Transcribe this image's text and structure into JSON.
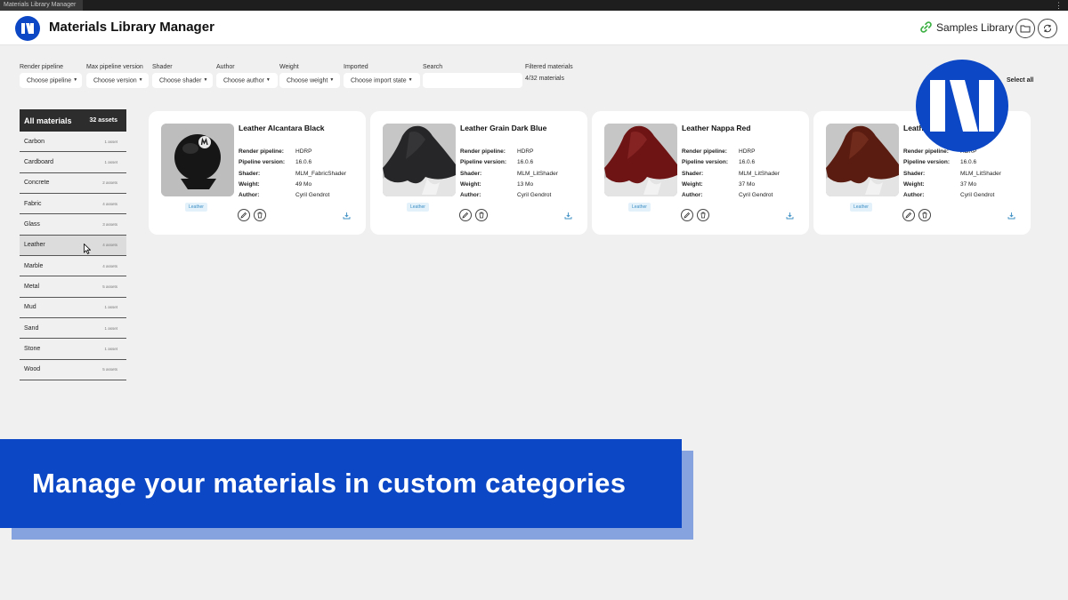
{
  "window": {
    "tab_title": "Materials Library Manager"
  },
  "header": {
    "title": "Materials Library Manager",
    "samples_label": "Samples Library",
    "logo_icon": "mlm-logo-icon",
    "accent": "#0c47c6"
  },
  "filters": [
    {
      "label": "Render pipeline",
      "placeholder": "Choose pipeline"
    },
    {
      "label": "Max pipeline version",
      "placeholder": "Choose version"
    },
    {
      "label": "Shader",
      "placeholder": "Choose shader"
    },
    {
      "label": "Author",
      "placeholder": "Choose author"
    },
    {
      "label": "Weight",
      "placeholder": "Choose weight"
    },
    {
      "label": "Imported",
      "placeholder": "Choose import state"
    }
  ],
  "search": {
    "label": "Search",
    "value": ""
  },
  "filtered": {
    "label": "Filtered materials",
    "count": "4/32 materials"
  },
  "select_all": "Select all",
  "sidebar": {
    "header": {
      "label": "All materials",
      "count": "32 assets"
    },
    "items": [
      {
        "name": "Carbon",
        "count": "1 asset"
      },
      {
        "name": "Cardboard",
        "count": "1 asset"
      },
      {
        "name": "Concrete",
        "count": "2 assets"
      },
      {
        "name": "Fabric",
        "count": "4 assets"
      },
      {
        "name": "Glass",
        "count": "3 assets"
      },
      {
        "name": "Leather",
        "count": "4 assets"
      },
      {
        "name": "Marble",
        "count": "4 assets"
      },
      {
        "name": "Metal",
        "count": "5 assets"
      },
      {
        "name": "Mud",
        "count": "1 asset"
      },
      {
        "name": "Sand",
        "count": "1 asset"
      },
      {
        "name": "Stone",
        "count": "1 asset"
      },
      {
        "name": "Wood",
        "count": "5 assets"
      }
    ]
  },
  "prop_labels": {
    "pipeline": "Render pipeline:",
    "version": "Pipeline version:",
    "shader": "Shader:",
    "weight": "Weight:",
    "author": "Author:"
  },
  "materials": [
    {
      "name": "Leather Alcantara Black",
      "pipeline": "HDRP",
      "version": "16.0.6",
      "shader": "MLM_FabricShader",
      "weight": "49 Mo",
      "author": "Cyril Gendrot",
      "tag": "Leather",
      "color": "#1c1c1c"
    },
    {
      "name": "Leather Grain Dark Blue",
      "pipeline": "HDRP",
      "version": "16.0.6",
      "shader": "MLM_LitShader",
      "weight": "13 Mo",
      "author": "Cyril Gendrot",
      "tag": "Leather",
      "color": "#262628"
    },
    {
      "name": "Leather Nappa Red",
      "pipeline": "HDRP",
      "version": "16.0.6",
      "shader": "MLM_LitShader",
      "weight": "37 Mo",
      "author": "Cyril Gendrot",
      "tag": "Leather",
      "color": "#6e1414"
    },
    {
      "name": "Leather Nappa Brown",
      "pipeline": "HDRP",
      "version": "16.0.6",
      "shader": "MLM_LitShader",
      "weight": "37 Mo",
      "author": "Cyril Gendrot",
      "tag": "Leather",
      "color": "#5a1c10"
    }
  ],
  "banner": {
    "text": "Manage your materials in custom categories"
  }
}
